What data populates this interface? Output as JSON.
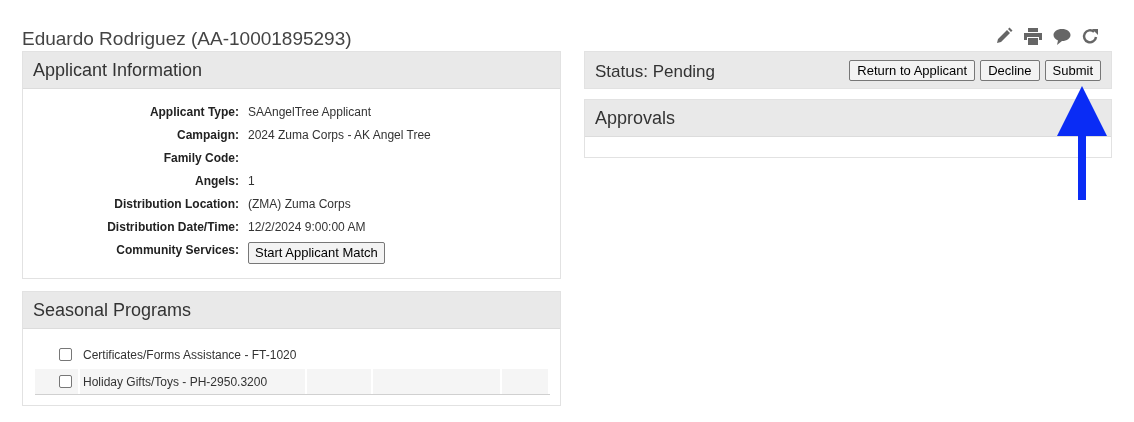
{
  "title": "Eduardo Rodriguez (AA-10001895293)",
  "applicant_information": {
    "heading": "Applicant Information",
    "fields": [
      {
        "label": "Applicant Type:",
        "value": "SAAngelTree Applicant"
      },
      {
        "label": "Campaign:",
        "value": "2024 Zuma Corps - AK Angel Tree"
      },
      {
        "label": "Family Code:"
      },
      {
        "label": "Angels:",
        "value": "1"
      },
      {
        "label": "Distribution Location:",
        "value": "(ZMA) Zuma Corps"
      },
      {
        "label": "Distribution Date/Time:",
        "value": "12/2/2024 9:00:00 AM"
      },
      {
        "label": "Community Services:",
        "button": "Start Applicant Match"
      }
    ]
  },
  "seasonal_programs": {
    "heading": "Seasonal Programs",
    "items": [
      {
        "label": "Certificates/Forms Assistance - FT-1020",
        "checked": false
      },
      {
        "label": "Holiday Gifts/Toys - PH-2950.3200",
        "checked": false
      }
    ]
  },
  "status": {
    "label": "Status: Pending",
    "buttons": [
      "Return to Applicant",
      "Decline",
      "Submit"
    ]
  },
  "approvals": {
    "heading": "Approvals"
  }
}
